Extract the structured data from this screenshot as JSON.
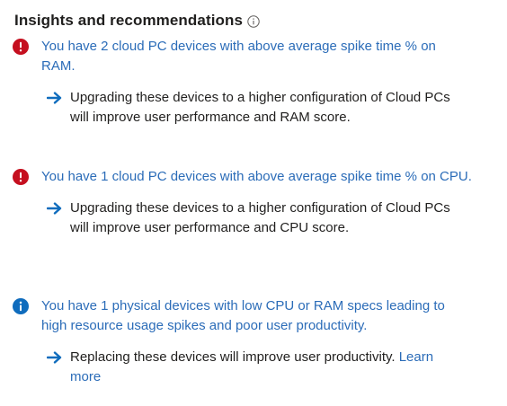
{
  "panel": {
    "title": "Insights and recommendations",
    "title_info_icon": "info-outline-icon"
  },
  "insights": [
    {
      "severity": "error",
      "icon": "error-circle-icon",
      "icon_color": "#c50f1f",
      "text": "You have 2 cloud PC devices with above average spike time % on RAM.",
      "recommendation": "Upgrading these devices to a higher configuration of Cloud PCs will improve user performance and RAM score."
    },
    {
      "severity": "error",
      "icon": "error-circle-icon",
      "icon_color": "#c50f1f",
      "text": "You have 1 cloud PC devices with above average spike time % on CPU.",
      "recommendation": "Upgrading these devices to a higher configuration of Cloud PCs will improve user performance and CPU score."
    },
    {
      "severity": "info",
      "icon": "info-circle-icon",
      "icon_color": "#0f6cbd",
      "text": "You have 1 physical devices with low CPU or RAM specs leading to high resource usage spikes and poor user productivity.",
      "recommendation": "Replacing these devices will improve user productivity.",
      "link_label": "Learn more"
    }
  ],
  "colors": {
    "link": "#2b6cb8",
    "arrow": "#0f6cbd",
    "text": "#201f1e"
  }
}
